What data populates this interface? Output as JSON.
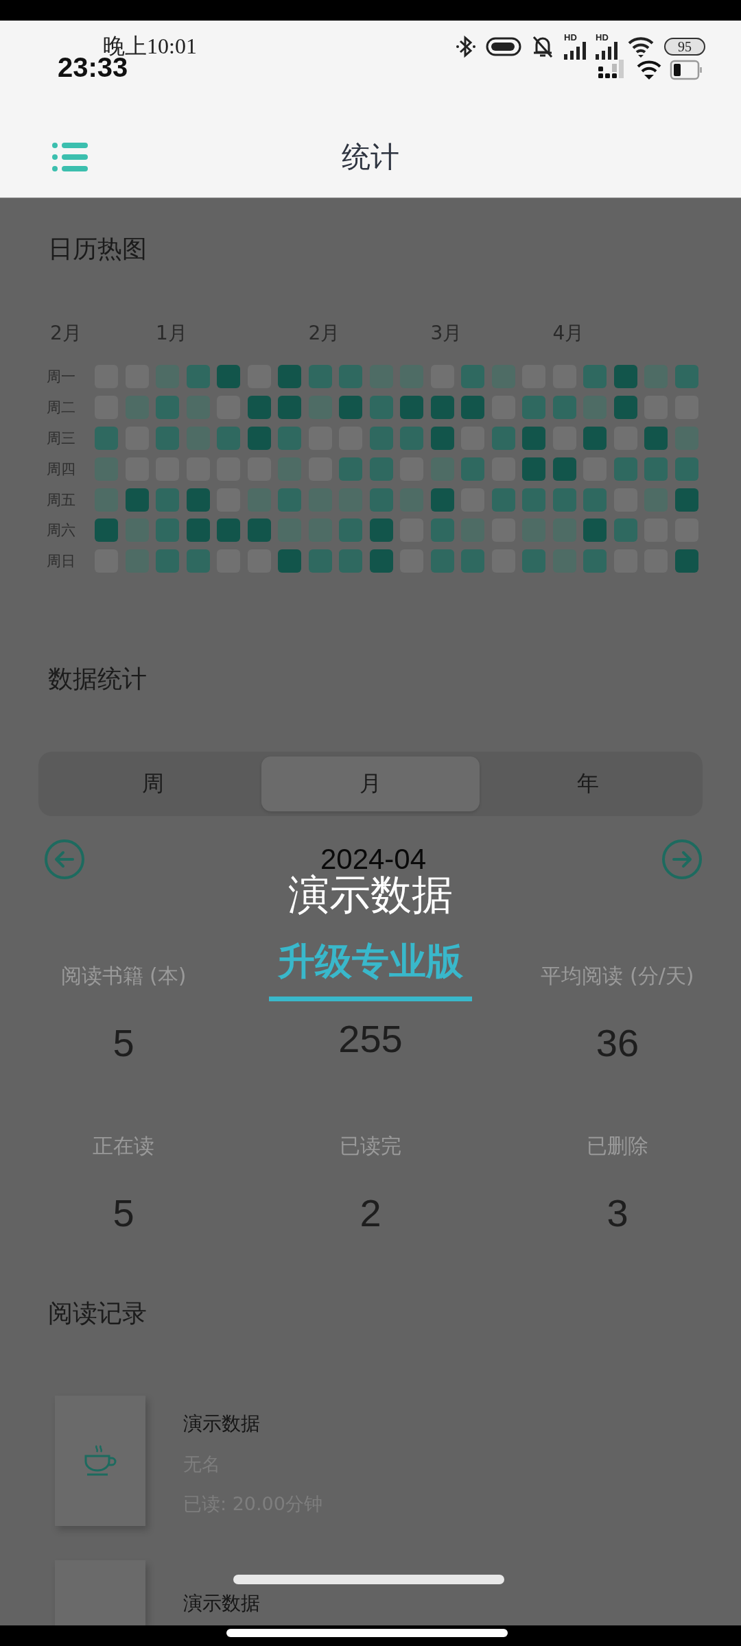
{
  "status_bar": {
    "time_small": "晚上10:01",
    "time": "23:33",
    "network_labels": [
      "HD",
      "HD"
    ],
    "battery": "95"
  },
  "header": {
    "title": "统计"
  },
  "heatmap": {
    "title": "日历热图",
    "corner_label": "2月",
    "day_labels": [
      "周一",
      "周二",
      "周三",
      "周四",
      "周五",
      "周六",
      "周日"
    ],
    "weeks": [
      {
        "cells": [
          {
            "color": "#717171"
          },
          {
            "color": "#717171"
          },
          {
            "color": "#2f6960"
          },
          {
            "color": "#4e6c65"
          },
          {
            "color": "#4e6c65"
          },
          {
            "color": "#12554b"
          },
          {
            "color": "#717171"
          }
        ]
      },
      {
        "cells": [
          {
            "color": "#717171"
          },
          {
            "color": "#4e6c65"
          },
          {
            "color": "#717171"
          },
          {
            "color": "#717171"
          },
          {
            "color": "#12554b"
          },
          {
            "color": "#4e6c65"
          },
          {
            "color": "#4e6c65"
          }
        ]
      },
      {
        "month": "1月",
        "cells": [
          {
            "color": "#4e6c65"
          },
          {
            "color": "#2f6960"
          },
          {
            "color": "#2f6960"
          },
          {
            "color": "#717171"
          },
          {
            "color": "#2f6960"
          },
          {
            "color": "#2f6960"
          },
          {
            "color": "#2f6960"
          }
        ]
      },
      {
        "cells": [
          {
            "color": "#2f6960"
          },
          {
            "color": "#4e6c65"
          },
          {
            "color": "#4e6c65"
          },
          {
            "color": "#717171"
          },
          {
            "color": "#12554b"
          },
          {
            "color": "#12554b"
          },
          {
            "color": "#2f6960"
          }
        ]
      },
      {
        "cells": [
          {
            "color": "#12554b"
          },
          {
            "color": "#717171"
          },
          {
            "color": "#2f6960"
          },
          {
            "color": "#717171"
          },
          {
            "color": "#717171"
          },
          {
            "color": "#12554b"
          },
          {
            "color": "#717171"
          }
        ]
      },
      {
        "cells": [
          {
            "color": "#717171"
          },
          {
            "color": "#12554b"
          },
          {
            "color": "#12554b"
          },
          {
            "color": "#717171"
          },
          {
            "color": "#4e6c65"
          },
          {
            "color": "#12554b"
          },
          {
            "color": "#717171"
          }
        ]
      },
      {
        "cells": [
          {
            "color": "#12554b"
          },
          {
            "color": "#12554b"
          },
          {
            "color": "#2f6960"
          },
          {
            "color": "#4e6c65"
          },
          {
            "color": "#2f6960"
          },
          {
            "color": "#4e6c65"
          },
          {
            "color": "#12554b"
          }
        ]
      },
      {
        "month": "2月",
        "cells": [
          {
            "color": "#2f6960"
          },
          {
            "color": "#4e6c65"
          },
          {
            "color": "#717171"
          },
          {
            "color": "#717171"
          },
          {
            "color": "#4e6c65"
          },
          {
            "color": "#4e6c65"
          },
          {
            "color": "#2f6960"
          }
        ]
      },
      {
        "cells": [
          {
            "color": "#2f6960"
          },
          {
            "color": "#12554b"
          },
          {
            "color": "#717171"
          },
          {
            "color": "#2f6960"
          },
          {
            "color": "#4e6c65"
          },
          {
            "color": "#2f6960"
          },
          {
            "color": "#2f6960"
          }
        ]
      },
      {
        "cells": [
          {
            "color": "#4e6c65"
          },
          {
            "color": "#2f6960"
          },
          {
            "color": "#2f6960"
          },
          {
            "color": "#2f6960"
          },
          {
            "color": "#2f6960"
          },
          {
            "color": "#12554b"
          },
          {
            "color": "#12554b"
          }
        ]
      },
      {
        "cells": [
          {
            "color": "#4e6c65"
          },
          {
            "color": "#12554b"
          },
          {
            "color": "#2f6960"
          },
          {
            "color": "#717171"
          },
          {
            "color": "#4e6c65"
          },
          {
            "color": "#717171"
          },
          {
            "color": "#717171"
          }
        ]
      },
      {
        "month": "3月",
        "cells": [
          {
            "color": "#717171"
          },
          {
            "color": "#12554b"
          },
          {
            "color": "#12554b"
          },
          {
            "color": "#4e6c65"
          },
          {
            "color": "#12554b"
          },
          {
            "color": "#2f6960"
          },
          {
            "color": "#2f6960"
          }
        ]
      },
      {
        "cells": [
          {
            "color": "#2f6960"
          },
          {
            "color": "#12554b"
          },
          {
            "color": "#717171"
          },
          {
            "color": "#2f6960"
          },
          {
            "color": "#717171"
          },
          {
            "color": "#4e6c65"
          },
          {
            "color": "#2f6960"
          }
        ]
      },
      {
        "cells": [
          {
            "color": "#4e6c65"
          },
          {
            "color": "#717171"
          },
          {
            "color": "#2f6960"
          },
          {
            "color": "#717171"
          },
          {
            "color": "#2f6960"
          },
          {
            "color": "#717171"
          },
          {
            "color": "#717171"
          }
        ]
      },
      {
        "cells": [
          {
            "color": "#717171"
          },
          {
            "color": "#2f6960"
          },
          {
            "color": "#12554b"
          },
          {
            "color": "#12554b"
          },
          {
            "color": "#2f6960"
          },
          {
            "color": "#4e6c65"
          },
          {
            "color": "#2f6960"
          }
        ]
      },
      {
        "month": "4月",
        "cells": [
          {
            "color": "#717171"
          },
          {
            "color": "#2f6960"
          },
          {
            "color": "#717171"
          },
          {
            "color": "#12554b"
          },
          {
            "color": "#2f6960"
          },
          {
            "color": "#4e6c65"
          },
          {
            "color": "#4e6c65"
          }
        ]
      },
      {
        "cells": [
          {
            "color": "#2f6960"
          },
          {
            "color": "#4e6c65"
          },
          {
            "color": "#12554b"
          },
          {
            "color": "#717171"
          },
          {
            "color": "#2f6960"
          },
          {
            "color": "#12554b"
          },
          {
            "color": "#2f6960"
          }
        ]
      },
      {
        "cells": [
          {
            "color": "#12554b"
          },
          {
            "color": "#12554b"
          },
          {
            "color": "#717171"
          },
          {
            "color": "#2f6960"
          },
          {
            "color": "#717171"
          },
          {
            "color": "#2f6960"
          },
          {
            "color": "#717171"
          }
        ]
      },
      {
        "cells": [
          {
            "color": "#4e6c65"
          },
          {
            "color": "#717171"
          },
          {
            "color": "#12554b"
          },
          {
            "color": "#2f6960"
          },
          {
            "color": "#4e6c65"
          },
          {
            "color": "#717171"
          },
          {
            "color": "#717171"
          }
        ]
      },
      {
        "cells": [
          {
            "color": "#2f6960"
          },
          {
            "color": "#717171"
          },
          {
            "color": "#4e6c65"
          },
          {
            "color": "#2f6960"
          },
          {
            "color": "#12554b"
          },
          {
            "color": "#717171"
          },
          {
            "color": "#12554b"
          }
        ]
      }
    ]
  },
  "stats": {
    "title": "数据统计",
    "tabs": [
      {
        "label": "周",
        "selected": false
      },
      {
        "label": "月",
        "selected": true
      },
      {
        "label": "年",
        "selected": false
      }
    ],
    "period": "2024-04",
    "metrics": [
      {
        "label": "阅读书籍 (本)",
        "value": "5"
      },
      {
        "value": "255"
      },
      {
        "label": "平均阅读 (分/天)",
        "value": "36"
      },
      {
        "label": "正在读",
        "value": "5"
      },
      {
        "label": "已读完",
        "value": "2"
      },
      {
        "label": "已删除",
        "value": "3"
      }
    ]
  },
  "reading_log": {
    "title": "阅读记录",
    "books": [
      {
        "title": "演示数据",
        "author": "无名",
        "progress": "已读: 20.00分钟"
      },
      {
        "title": "演示数据"
      }
    ]
  },
  "overlay": {
    "label": "演示数据",
    "upgrade": "升级专业版"
  }
}
